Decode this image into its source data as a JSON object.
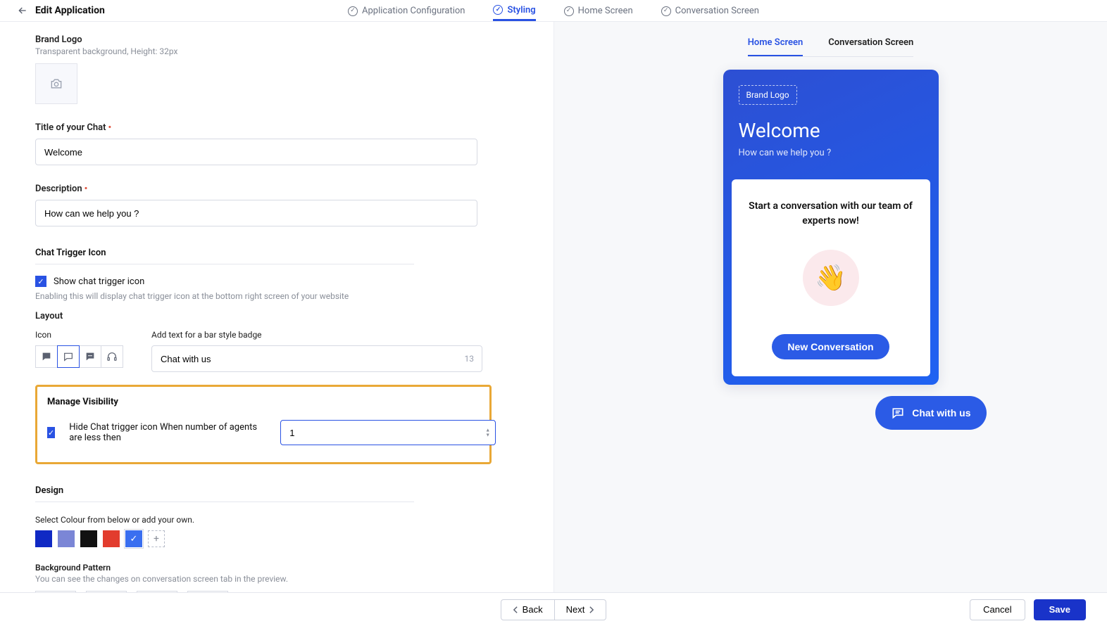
{
  "header": {
    "title": "Edit Application",
    "steps": [
      {
        "label": "Application Configuration",
        "active": false
      },
      {
        "label": "Styling",
        "active": true
      },
      {
        "label": "Home Screen",
        "active": false
      },
      {
        "label": "Conversation Screen",
        "active": false
      }
    ]
  },
  "brand_logo": {
    "label": "Brand Logo",
    "hint": "Transparent background, Height: 32px"
  },
  "chat_title": {
    "label": "Title of your Chat",
    "value": "Welcome"
  },
  "description": {
    "label": "Description",
    "value": "How can we help you ?"
  },
  "trigger": {
    "section": "Chat Trigger Icon",
    "show_label": "Show chat trigger icon",
    "show_hint": "Enabling this will display chat trigger icon at the bottom right screen of your website",
    "layout_label": "Layout",
    "icon_label": "Icon",
    "bar_label": "Add text for a bar style badge",
    "bar_value": "Chat with us",
    "bar_counter": "13"
  },
  "visibility": {
    "section": "Manage Visibility",
    "label": "Hide Chat trigger icon When number of agents are less then",
    "value": "1"
  },
  "design": {
    "section": "Design",
    "color_label": "Select Colour from below or add your own.",
    "colors": [
      "#1029c4",
      "#7b86d6",
      "#111111",
      "#e23c2e",
      "#3a6ff0"
    ],
    "selected_color_index": 4,
    "pattern_label": "Background Pattern",
    "pattern_hint": "You can see the changes on conversation screen tab in the preview."
  },
  "preview": {
    "tabs": [
      "Home Screen",
      "Conversation Screen"
    ],
    "active_tab": 0,
    "brand_placeholder": "Brand Logo",
    "title": "Welcome",
    "subtitle": "How can we help you ?",
    "card_text": "Start a conversation with our team of experts now!",
    "new_conv": "New Conversation",
    "chat_badge": "Chat with us"
  },
  "footer": {
    "back": "Back",
    "next": "Next",
    "cancel": "Cancel",
    "save": "Save"
  }
}
